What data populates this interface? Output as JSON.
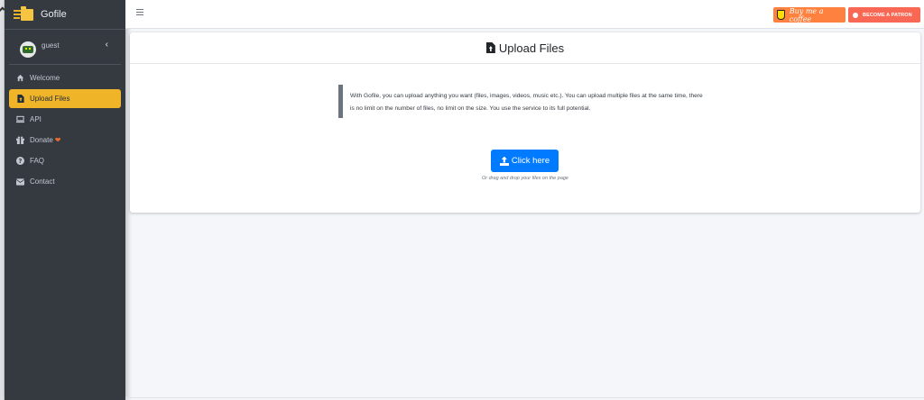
{
  "brand": {
    "title": "Gofile"
  },
  "user": {
    "name": "guest",
    "toggle_glyph": "‹"
  },
  "sidebar": {
    "items": [
      {
        "label": "Welcome",
        "icon": "home-icon",
        "active": false
      },
      {
        "label": "Upload Files",
        "icon": "file-upload-icon",
        "active": true
      },
      {
        "label": "API",
        "icon": "laptop-icon",
        "active": false
      },
      {
        "label": "Donate",
        "icon": "gift-icon",
        "active": false,
        "suffix_icon": "heart-icon",
        "suffix_glyph": "❤"
      },
      {
        "label": "FAQ",
        "icon": "question-circle-icon",
        "active": false
      },
      {
        "label": "Contact",
        "icon": "envelope-icon",
        "active": false
      }
    ]
  },
  "navbar": {
    "menu_icon": "hamburger-icon",
    "coffee_label": "Buy me a coffee",
    "patron_label": "BECOME A PATRON"
  },
  "main": {
    "title": "Upload Files",
    "description": "With Gofile, you can upload anything you want (files, images, videos, music etc.). You can upload multiple files at the same time, there is no limit on the number of files, no limit on the size. You use the service to its full potential.",
    "upload_button_label": "Click here",
    "drop_hint": "Or drag and drop your files on the page"
  },
  "colors": {
    "sidebar_bg": "#343a40",
    "active_item": "#f0b429",
    "primary_button": "#007bff",
    "coffee_button": "#ff813f",
    "patron_button": "#f96854",
    "page_bg": "#f4f6f9"
  }
}
